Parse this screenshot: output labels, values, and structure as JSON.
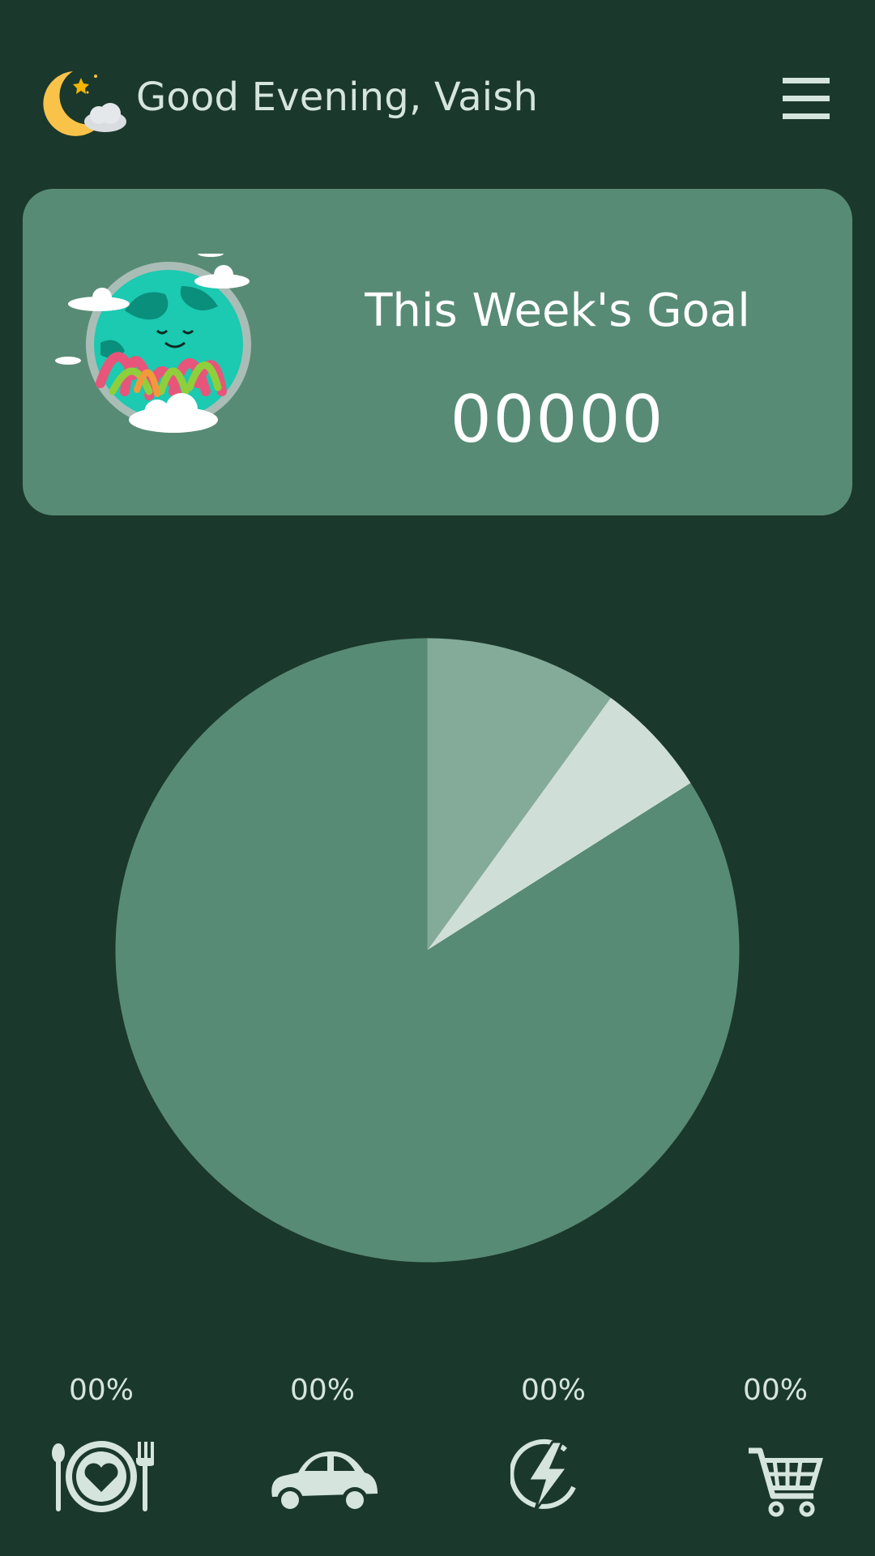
{
  "header": {
    "greeting": "Good Evening, Vaish",
    "weather_icon": "moon-cloud-icon",
    "menu_icon": "hamburger-menu-icon"
  },
  "goal_card": {
    "title": "This Week's Goal",
    "value": "00000",
    "illustration": "happy-earth-illustration"
  },
  "chart_data": {
    "type": "pie",
    "slices": [
      {
        "value": 10,
        "color": "#84ab9a"
      },
      {
        "value": 6,
        "color": "#cfdfd7"
      },
      {
        "value": 84,
        "color": "#588b75"
      }
    ]
  },
  "categories": [
    {
      "icon": "food-plate-icon",
      "percent": "00%"
    },
    {
      "icon": "car-icon",
      "percent": "00%"
    },
    {
      "icon": "electricity-bolt-icon",
      "percent": "00%"
    },
    {
      "icon": "shopping-cart-icon",
      "percent": "00%"
    }
  ],
  "colors": {
    "background": "#1b382c",
    "card": "#588b75",
    "text_light": "#d5e5dd",
    "accent_moon": "#f9c34a"
  }
}
